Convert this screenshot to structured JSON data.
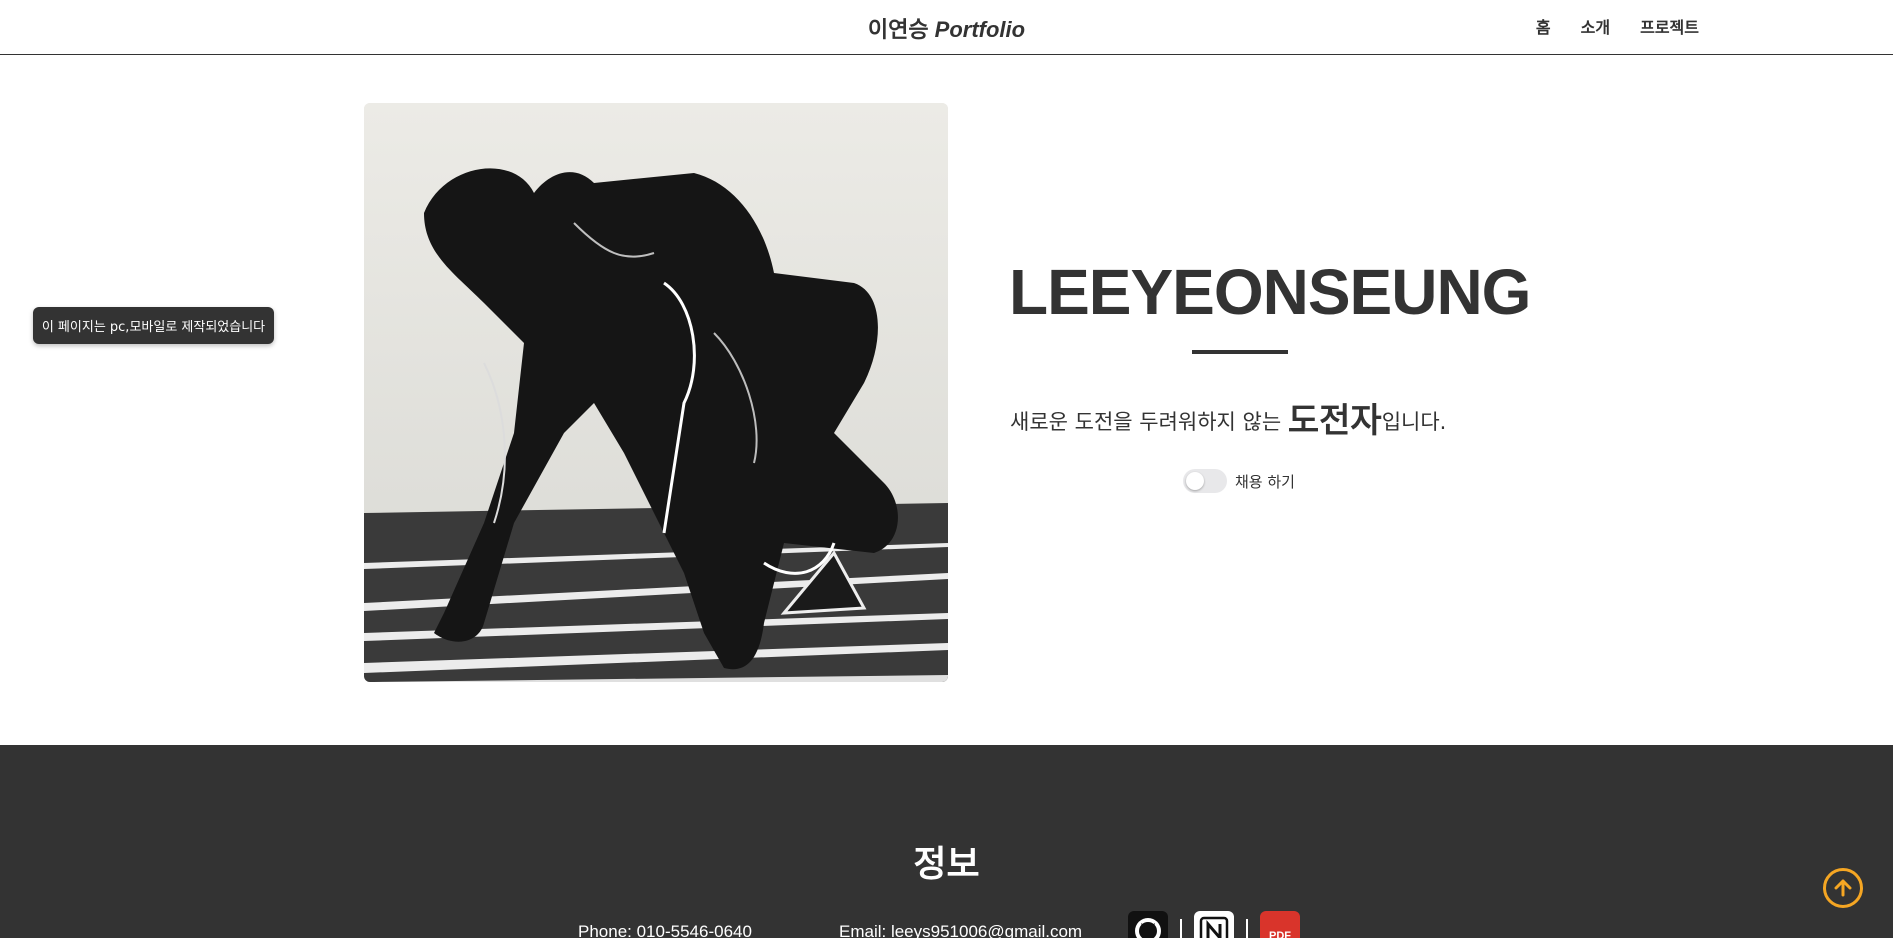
{
  "header": {
    "logo_name": "이연승",
    "logo_accent": "Portfolio",
    "nav": [
      {
        "label": "홈"
      },
      {
        "label": "소개"
      },
      {
        "label": "프로젝트"
      }
    ]
  },
  "notice": {
    "text": "이 페이지는 pc,모바일로 제작되었습니다"
  },
  "hero": {
    "title": "LEEYEONSEUNG",
    "subtitle_prefix": "새로운 도전을 두려워하지 않는",
    "subtitle_emphasis": "도전자",
    "subtitle_suffix": "입니다.",
    "toggle_label": "채용 하기",
    "toggle_on": false
  },
  "footer": {
    "title": "정보",
    "phone": "Phone: 010-5546-0640",
    "email": "Email: leeys951006@gmail.com",
    "icons": [
      "github-icon",
      "notion-icon",
      "pdf-icon"
    ],
    "pdf_badge": "PDF"
  },
  "colors": {
    "dark": "#333333",
    "accent_orange": "#f5a623",
    "pdf_red": "#d9342b"
  }
}
